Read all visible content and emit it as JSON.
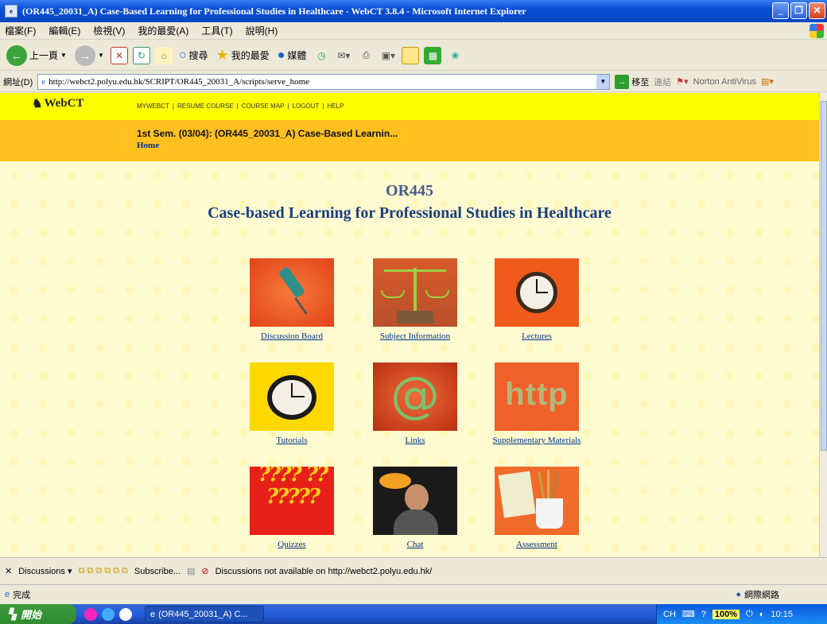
{
  "window": {
    "title": "(OR445_20031_A) Case-Based Learning for Professional Studies in Healthcare - WebCT 3.8.4 - Microsoft Internet Explorer"
  },
  "menu": [
    "檔案(F)",
    "編輯(E)",
    "檢視(V)",
    "我的最愛(A)",
    "工具(T)",
    "說明(H)"
  ],
  "toolbar": {
    "back": "上一頁",
    "search": "搜尋",
    "favorites": "我的最愛",
    "media": "媒體"
  },
  "address": {
    "label": "網址(D)",
    "url": "http://webct2.polyu.edu.hk/SCRIPT/OR445_20031_A/scripts/serve_home",
    "go": "移至",
    "links": "連結",
    "norton": "Norton AntiVirus"
  },
  "webct": {
    "logo": "WebCT",
    "nav": [
      "MYWEBCT",
      "RESUME COURSE",
      "COURSE MAP",
      "LOGOUT",
      "HELP"
    ],
    "course_title": "1st Sem. (03/04): (OR445_20031_A) Case-Based Learnin...",
    "breadcrumb": "Home"
  },
  "page": {
    "code": "OR445",
    "name": "Case-based Learning for Professional Studies in Healthcare"
  },
  "tiles": [
    {
      "label": "Discussion Board",
      "icon": "pushpin-icon"
    },
    {
      "label": "Subject Information",
      "icon": "scales-icon"
    },
    {
      "label": "Lectures",
      "icon": "clock-icon"
    },
    {
      "label": "Tutorials",
      "icon": "clock-icon"
    },
    {
      "label": "Links",
      "icon": "at-sign-icon"
    },
    {
      "label": "Supplementary Materials",
      "icon": "http-icon"
    },
    {
      "label": "Quizzes",
      "icon": "question-marks-icon"
    },
    {
      "label": "Chat",
      "icon": "phone-person-icon"
    },
    {
      "label": "Assessment",
      "icon": "pencil-cup-icon"
    }
  ],
  "discussions": {
    "label": "Discussions",
    "subscribe": "Subscribe...",
    "message": "Discussions not available on http://webct2.polyu.edu.hk/"
  },
  "status": {
    "text": "完成",
    "zone": "網際網路"
  },
  "taskbar": {
    "start": "開始",
    "task": "(OR445_20031_A) C...",
    "lang": "CH",
    "zoom": "100%",
    "time": "10:15"
  },
  "colors": {
    "webct_bar": "#ffff00",
    "course_bar": "#ffc020",
    "course_name": "#1a3f80",
    "link": "#00338f"
  }
}
